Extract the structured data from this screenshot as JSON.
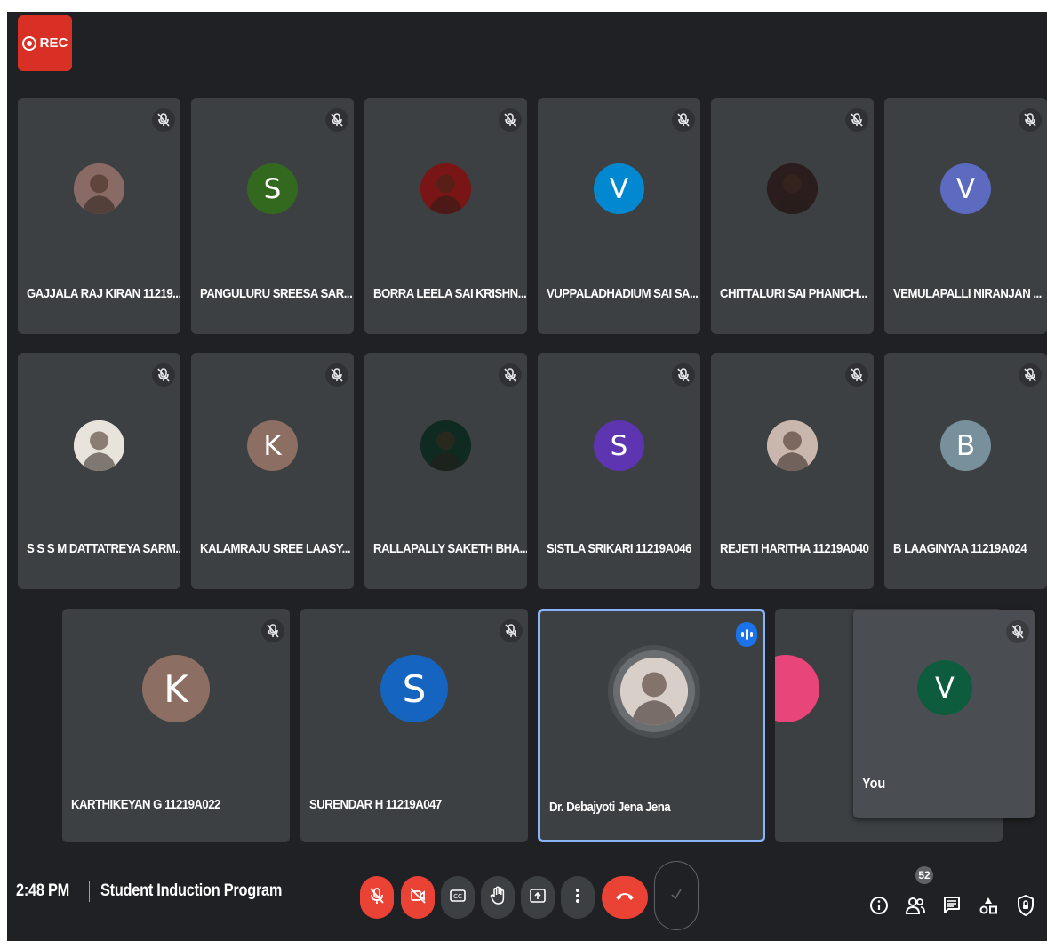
{
  "recording": {
    "label": "REC"
  },
  "participants_row1": [
    {
      "name": "GAJJALA RAJ KIRAN 11219...",
      "initial": "",
      "color": "#8a6a64",
      "photo": true
    },
    {
      "name": "PANGULURU SREESA SAR...",
      "initial": "S",
      "color": "#33691e",
      "photo": false
    },
    {
      "name": "BORRA LEELA SAI KRISHN...",
      "initial": "",
      "color": "#7a1515",
      "photo": true
    },
    {
      "name": "VUPPALADHADIUM SAI SA...",
      "initial": "V",
      "color": "#0288d1",
      "photo": false
    },
    {
      "name": "CHITTALURI SAI PHANICH...",
      "initial": "",
      "color": "#2b1d1d",
      "photo": true
    },
    {
      "name": "VEMULAPALLI NIRANJAN ...",
      "initial": "V",
      "color": "#5c6bc0",
      "photo": false
    }
  ],
  "participants_row2": [
    {
      "name": "S S S M DATTATREYA SARM...",
      "initial": "",
      "color": "#e8e4dc",
      "photo": true
    },
    {
      "name": "KALAMRAJU SREE LAASY...",
      "initial": "K",
      "color": "#8d6e63",
      "photo": false
    },
    {
      "name": "RALLAPALLY SAKETH BHA...",
      "initial": "",
      "color": "#0f2a20",
      "photo": true
    },
    {
      "name": "SISTLA SRIKARI 11219A046",
      "initial": "S",
      "color": "#5e35b1",
      "photo": false
    },
    {
      "name": "REJETI HARITHA 11219A040",
      "initial": "",
      "color": "#c9b7ad",
      "photo": true
    },
    {
      "name": "B LAAGINYAA 11219A024",
      "initial": "B",
      "color": "#78909c",
      "photo": false
    }
  ],
  "participants_row3": [
    {
      "name": "KARTHIKEYAN G 11219A022",
      "initial": "K",
      "color": "#8d6e63",
      "photo": false
    },
    {
      "name": "SURENDAR H 11219A047",
      "initial": "S",
      "color": "#1565c0",
      "photo": false
    },
    {
      "name": "Dr. Debajyoti Jena Jena",
      "initial": "",
      "color": "#d9cfc9",
      "photo": true,
      "speaking": true
    },
    {
      "name": "",
      "initial": "",
      "color": "#e8457a",
      "photo": false
    }
  ],
  "self_view": {
    "name": "You",
    "initial": "V",
    "color": "#0d5c3e"
  },
  "meeting": {
    "time": "2:48 PM",
    "title": "Student Induction Program"
  },
  "participant_count": "52",
  "colors": {
    "background": "#202124",
    "tile": "#3c4043",
    "danger": "#ea4335",
    "accent": "#8ab4f8"
  },
  "icons": {
    "controls": [
      "mic-off-icon",
      "camera-off-icon",
      "captions-icon",
      "raise-hand-icon",
      "present-icon",
      "more-options-icon",
      "leave-call-icon",
      "check-icon"
    ],
    "right": [
      "info-icon",
      "people-icon",
      "chat-icon",
      "activities-icon",
      "host-controls-icon"
    ]
  }
}
